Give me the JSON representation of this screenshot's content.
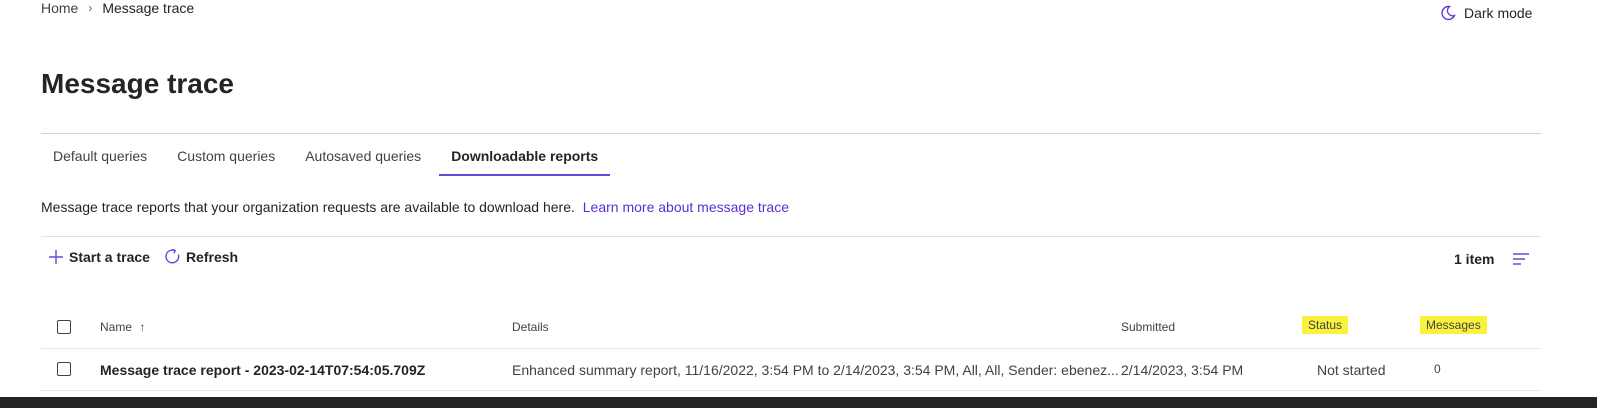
{
  "breadcrumb": {
    "home": "Home",
    "separator": "›",
    "current": "Message trace"
  },
  "header": {
    "dark_mode_label": "Dark mode",
    "dark_mode_icon": "moon-icon"
  },
  "page": {
    "title": "Message trace"
  },
  "tabs": [
    {
      "label": "Default queries",
      "active": false
    },
    {
      "label": "Custom queries",
      "active": false
    },
    {
      "label": "Autosaved queries",
      "active": false
    },
    {
      "label": "Downloadable reports",
      "active": true
    }
  ],
  "description": {
    "text": "Message trace reports that your organization requests are available to download here.",
    "link_text": "Learn more about message trace"
  },
  "commandbar": {
    "start_trace_label": "Start a trace",
    "refresh_label": "Refresh",
    "item_count": "1 item"
  },
  "table": {
    "columns": {
      "name": "Name",
      "details": "Details",
      "submitted": "Submitted",
      "status": "Status",
      "messages": "Messages"
    },
    "sort_indicator": "↑",
    "rows": [
      {
        "name": "Message trace report - 2023-02-14T07:54:05.709Z",
        "details": "Enhanced summary report, 11/16/2022, 3:54 PM to 2/14/2023, 3:54 PM, All, All, Sender: ebenez...",
        "submitted": "2/14/2023, 3:54 PM",
        "status": "Not started",
        "messages": "0"
      }
    ]
  },
  "colors": {
    "accent": "#6b47d6",
    "link": "#5c2ed6",
    "highlight": "#fbf23d"
  }
}
